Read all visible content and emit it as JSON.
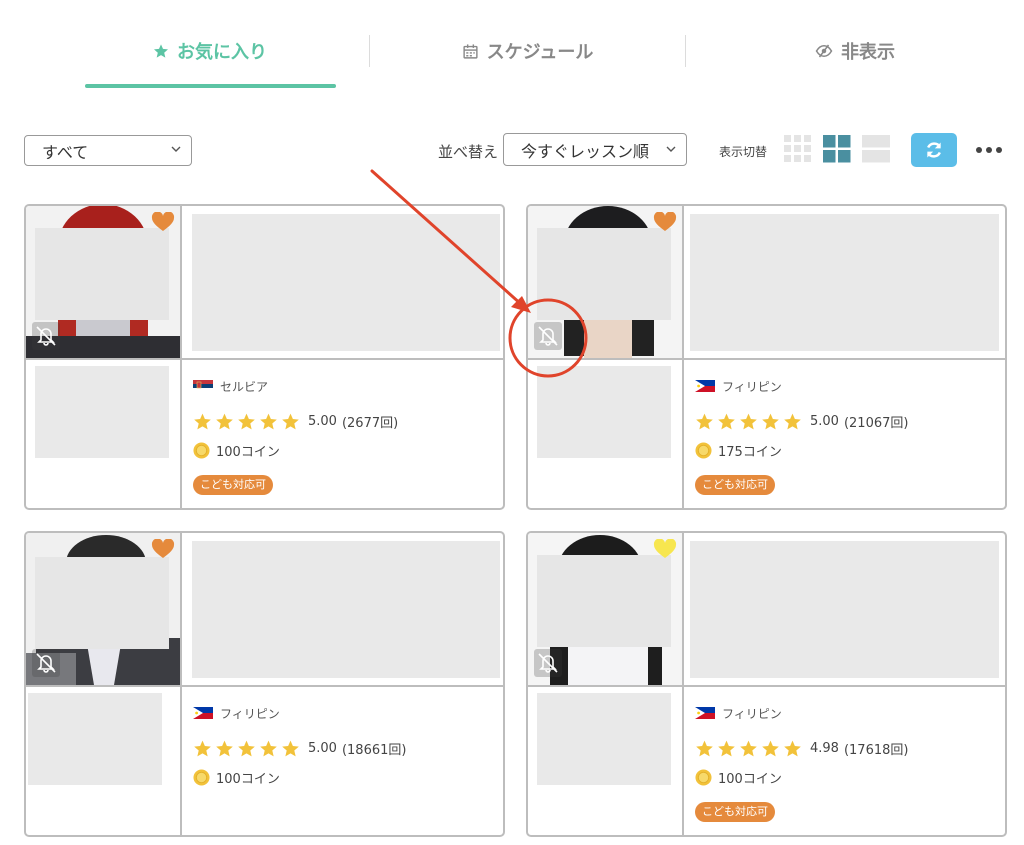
{
  "tabs": [
    {
      "label": "お気に入り",
      "icon": "star-icon",
      "active": true
    },
    {
      "label": "スケジュール",
      "icon": "calendar-icon",
      "active": false
    },
    {
      "label": "非表示",
      "icon": "eye-slash-icon",
      "active": false
    }
  ],
  "toolbar": {
    "filter_value": "すべて",
    "sort_label": "並べ替え",
    "sort_value": "今すぐレッスン順",
    "view_label": "表示切替",
    "active_view": "grid-2"
  },
  "colors": {
    "accent": "#5cc4a4",
    "refresh": "#5bbde8",
    "star": "#f2c23a",
    "heart_orange": "#e58a3c",
    "heart_yellow": "#f7e64f",
    "badge": "#e58a3c",
    "annotation": "#e0442b"
  },
  "cards": [
    {
      "country": "セルビア",
      "flag": "serbia",
      "rating": "5.00",
      "lessons": "(2677回)",
      "coins": "100コイン",
      "badge": "こども対応可",
      "heart": "orange",
      "stars": 5
    },
    {
      "country": "フィリピン",
      "flag": "philippines",
      "rating": "5.00",
      "lessons": "(21067回)",
      "coins": "175コイン",
      "badge": "こども対応可",
      "heart": "orange",
      "stars": 5
    },
    {
      "country": "フィリピン",
      "flag": "philippines",
      "rating": "5.00",
      "lessons": "(18661回)",
      "coins": "100コイン",
      "badge": "",
      "heart": "orange",
      "stars": 5
    },
    {
      "country": "フィリピン",
      "flag": "philippines",
      "rating": "4.98",
      "lessons": "(17618回)",
      "coins": "100コイン",
      "badge": "こども対応可",
      "heart": "yellow",
      "stars": 5
    }
  ]
}
